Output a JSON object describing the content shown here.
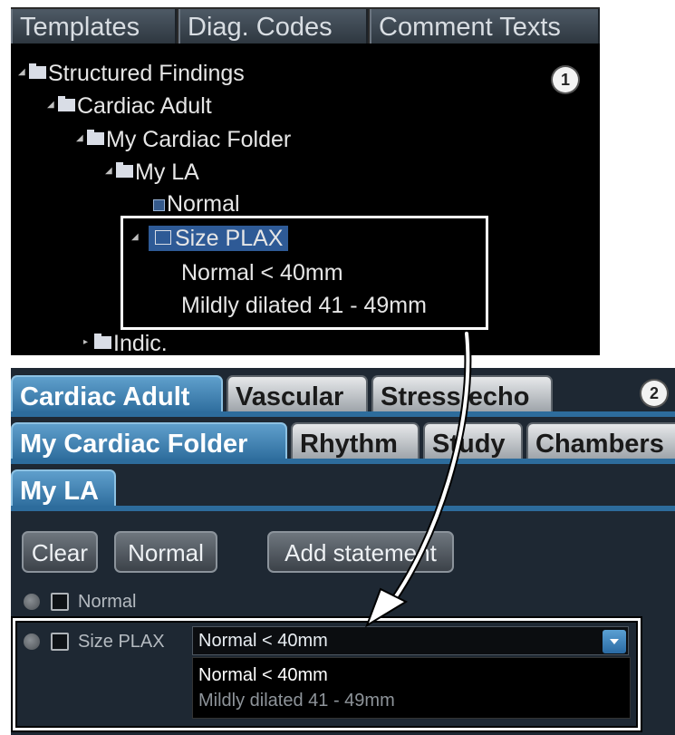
{
  "panel1": {
    "tabs": [
      "Templates",
      "Diag. Codes",
      "Comment Texts"
    ],
    "badge": "1",
    "tree": {
      "structured_findings": "Structured Findings",
      "cardiac_adult": "Cardiac Adult",
      "my_cardiac_folder": "My Cardiac Folder",
      "my_la": "My LA",
      "normal": "Normal",
      "size_plax": "Size PLAX",
      "option1": "Normal < 40mm",
      "option2": "Mildly dilated 41 - 49mm",
      "indic": "Indic."
    }
  },
  "panel2": {
    "badge": "2",
    "tabs_row1": [
      "Cardiac Adult",
      "Vascular",
      "Stress echo"
    ],
    "tabs_row2": [
      "My Cardiac Folder",
      "Rhythm",
      "Study",
      "Chambers"
    ],
    "tabs_row3": [
      "My LA"
    ],
    "buttons": {
      "clear": "Clear",
      "normal": "Normal",
      "add_statement": "Add statement"
    },
    "normal_label": "Normal",
    "size_plax_label": "Size PLAX",
    "combo_value": "Normal < 40mm",
    "dropdown_options": [
      "Normal < 40mm",
      "Mildly dilated 41 - 49mm"
    ]
  },
  "colors": {
    "selection": "#2e5a96",
    "active_tab": "#3d82b5",
    "panel2_bg": "#1e2833"
  }
}
